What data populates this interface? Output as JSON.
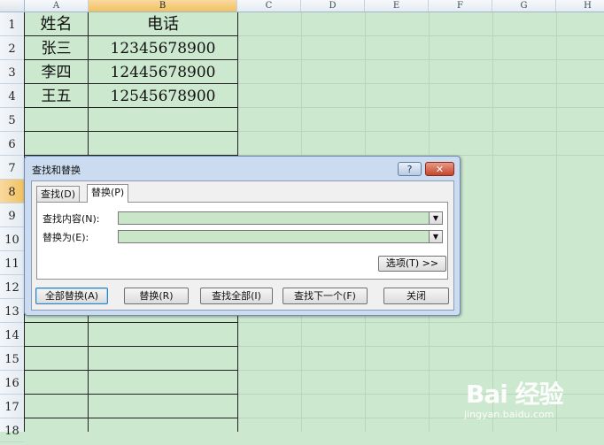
{
  "columns": [
    {
      "label": "A",
      "sel": false
    },
    {
      "label": "B",
      "sel": true
    },
    {
      "label": "C",
      "sel": false
    },
    {
      "label": "D",
      "sel": false
    },
    {
      "label": "E",
      "sel": false
    },
    {
      "label": "F",
      "sel": false
    },
    {
      "label": "G",
      "sel": false
    },
    {
      "label": "H",
      "sel": false
    }
  ],
  "rows": [
    "1",
    "2",
    "3",
    "4",
    "5",
    "6",
    "7",
    "8",
    "9",
    "10",
    "11",
    "12",
    "13",
    "14",
    "15",
    "16",
    "17",
    "18"
  ],
  "selected_row": "8",
  "table": {
    "header": {
      "name": "姓名",
      "phone": "电话"
    },
    "records": [
      {
        "name": "张三",
        "phone": "12345678900"
      },
      {
        "name": "李四",
        "phone": "12445678900"
      },
      {
        "name": "王五",
        "phone": "12545678900"
      }
    ]
  },
  "dialog": {
    "title": "查找和替换",
    "help_label": "?",
    "close_label": "✕",
    "tabs": [
      {
        "label": "查找(D)",
        "active": false
      },
      {
        "label": "替换(P)",
        "active": true
      }
    ],
    "find_label": "查找内容(N):",
    "find_value": "",
    "replace_label": "替换为(E):",
    "replace_value": "",
    "dropdown_glyph": "▼",
    "options_label": "选项(T) >>",
    "buttons": {
      "replace_all": "全部替换(A)",
      "replace": "替换(R)",
      "find_all": "查找全部(I)",
      "find_next": "查找下一个(F)",
      "close": "关闭"
    }
  },
  "watermark": {
    "logo": "Bai 经验",
    "url": "jingyan.baidu.com"
  },
  "colors": {
    "sheet_bg": "#cce8cf",
    "selected_header": "#f1c15f",
    "dialog_frame": "#cbdcf0"
  }
}
